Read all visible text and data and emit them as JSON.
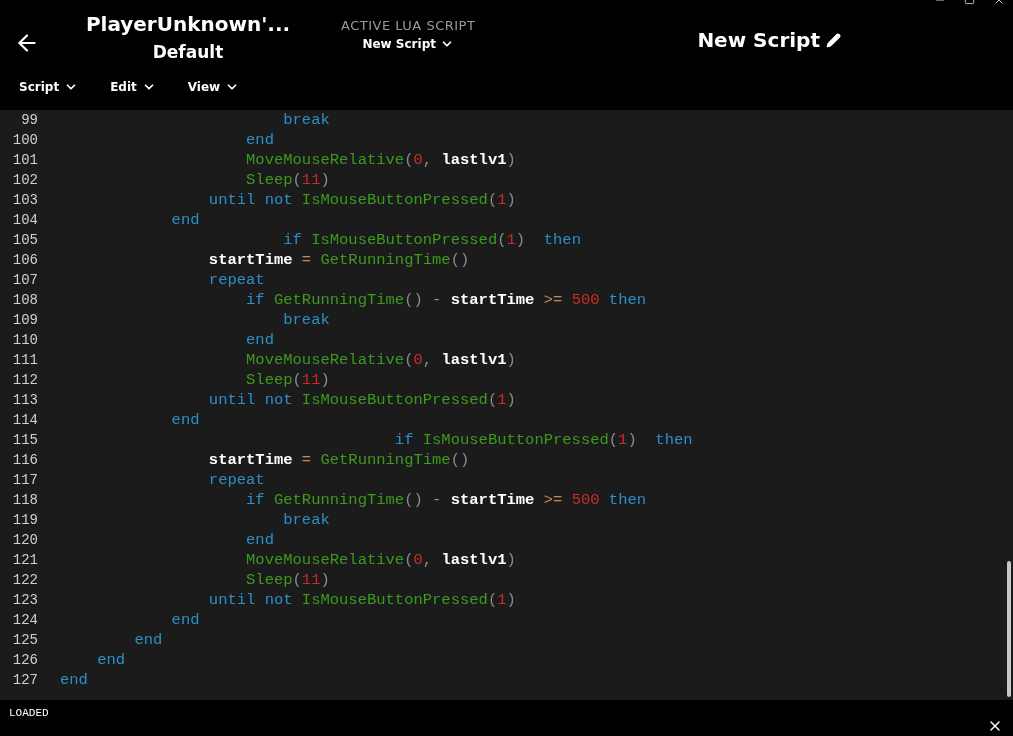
{
  "header": {
    "device_title": "PlayerUnknown'...",
    "profile": "Default",
    "active_label": "ACTIVE LUA SCRIPT",
    "active_script": "New Script",
    "script_name": "New Script"
  },
  "menus": [
    {
      "label": "Script"
    },
    {
      "label": "Edit"
    },
    {
      "label": "View"
    }
  ],
  "lines": [
    {
      "number": "99",
      "tokens": [
        {
          "keyword": "                        break"
        }
      ]
    },
    {
      "number": "100",
      "tokens": [
        {
          "keyword": "                    end"
        }
      ]
    },
    {
      "number": "101",
      "tokens": [
        {
          "function": "                    MoveMouseRelative"
        },
        {
          "punct": "("
        },
        {
          "number": "0"
        },
        {
          "punct": ", "
        },
        {
          "name": "lastlv1"
        },
        {
          "punct": ")"
        }
      ]
    },
    {
      "number": "102",
      "tokens": [
        {
          "function": "                    Sleep"
        },
        {
          "punct": "("
        },
        {
          "number": "11"
        },
        {
          "punct": ")"
        }
      ]
    },
    {
      "number": "103",
      "tokens": [
        {
          "keyword": "                until not "
        },
        {
          "function": "IsMouseButtonPressed"
        },
        {
          "punct": "("
        },
        {
          "number": "1"
        },
        {
          "punct": ")"
        }
      ]
    },
    {
      "number": "104",
      "tokens": [
        {
          "keyword": "            end"
        }
      ]
    },
    {
      "number": "105",
      "tokens": [
        {
          "keyword": "                        if "
        },
        {
          "function": "IsMouseButtonPressed"
        },
        {
          "punct": "("
        },
        {
          "number": "1"
        },
        {
          "punct": ")"
        },
        {
          "keyword": "  then"
        }
      ]
    },
    {
      "number": "106",
      "tokens": [
        {
          "name": "                startTime"
        },
        {
          "operator": " = "
        },
        {
          "function": "GetRunningTime"
        },
        {
          "punct": "()"
        }
      ]
    },
    {
      "number": "107",
      "tokens": [
        {
          "keyword": "                repeat"
        }
      ]
    },
    {
      "number": "108",
      "tokens": [
        {
          "keyword": "                    if "
        },
        {
          "function": "GetRunningTime"
        },
        {
          "punct": "()"
        },
        {
          "operator": " - "
        },
        {
          "name": "startTime"
        },
        {
          "operator": " >= "
        },
        {
          "number": "500"
        },
        {
          "keyword": " then"
        }
      ]
    },
    {
      "number": "109",
      "tokens": [
        {
          "keyword": "                        break"
        }
      ]
    },
    {
      "number": "110",
      "tokens": [
        {
          "keyword": "                    end"
        }
      ]
    },
    {
      "number": "111",
      "tokens": [
        {
          "function": "                    MoveMouseRelative"
        },
        {
          "punct": "("
        },
        {
          "number": "0"
        },
        {
          "punct": ", "
        },
        {
          "name": "lastlv1"
        },
        {
          "punct": ")"
        }
      ]
    },
    {
      "number": "112",
      "tokens": [
        {
          "function": "                    Sleep"
        },
        {
          "punct": "("
        },
        {
          "number": "11"
        },
        {
          "punct": ")"
        }
      ]
    },
    {
      "number": "113",
      "tokens": [
        {
          "keyword": "                until not "
        },
        {
          "function": "IsMouseButtonPressed"
        },
        {
          "punct": "("
        },
        {
          "number": "1"
        },
        {
          "punct": ")"
        }
      ]
    },
    {
      "number": "114",
      "tokens": [
        {
          "keyword": "            end"
        }
      ]
    },
    {
      "number": "115",
      "tokens": [
        {
          "keyword": "                                    if "
        },
        {
          "function": "IsMouseButtonPressed"
        },
        {
          "punct": "("
        },
        {
          "number": "1"
        },
        {
          "punct": ")"
        },
        {
          "keyword": "  then"
        }
      ]
    },
    {
      "number": "116",
      "tokens": [
        {
          "name": "                startTime"
        },
        {
          "operator": " = "
        },
        {
          "function": "GetRunningTime"
        },
        {
          "punct": "()"
        }
      ]
    },
    {
      "number": "117",
      "tokens": [
        {
          "keyword": "                repeat"
        }
      ]
    },
    {
      "number": "118",
      "tokens": [
        {
          "keyword": "                    if "
        },
        {
          "function": "GetRunningTime"
        },
        {
          "punct": "()"
        },
        {
          "operator": " - "
        },
        {
          "name": "startTime"
        },
        {
          "operator": " >= "
        },
        {
          "number": "500"
        },
        {
          "keyword": " then"
        }
      ]
    },
    {
      "number": "119",
      "tokens": [
        {
          "keyword": "                        break"
        }
      ]
    },
    {
      "number": "120",
      "tokens": [
        {
          "keyword": "                    end"
        }
      ]
    },
    {
      "number": "121",
      "tokens": [
        {
          "function": "                    MoveMouseRelative"
        },
        {
          "punct": "("
        },
        {
          "number": "0"
        },
        {
          "punct": ", "
        },
        {
          "name": "lastlv1"
        },
        {
          "punct": ")"
        }
      ]
    },
    {
      "number": "122",
      "tokens": [
        {
          "function": "                    Sleep"
        },
        {
          "punct": "("
        },
        {
          "number": "11"
        },
        {
          "punct": ")"
        }
      ]
    },
    {
      "number": "123",
      "tokens": [
        {
          "keyword": "                until not "
        },
        {
          "function": "IsMouseButtonPressed"
        },
        {
          "punct": "("
        },
        {
          "number": "1"
        },
        {
          "punct": ")"
        }
      ]
    },
    {
      "number": "124",
      "tokens": [
        {
          "keyword": "            end"
        }
      ]
    },
    {
      "number": "125",
      "tokens": [
        {
          "keyword": "        end"
        }
      ]
    },
    {
      "number": "126",
      "tokens": [
        {
          "keyword": "    end"
        }
      ]
    },
    {
      "number": "127",
      "tokens": [
        {
          "keyword": "end"
        }
      ]
    }
  ],
  "status_bar": {
    "text": "LOADED"
  }
}
